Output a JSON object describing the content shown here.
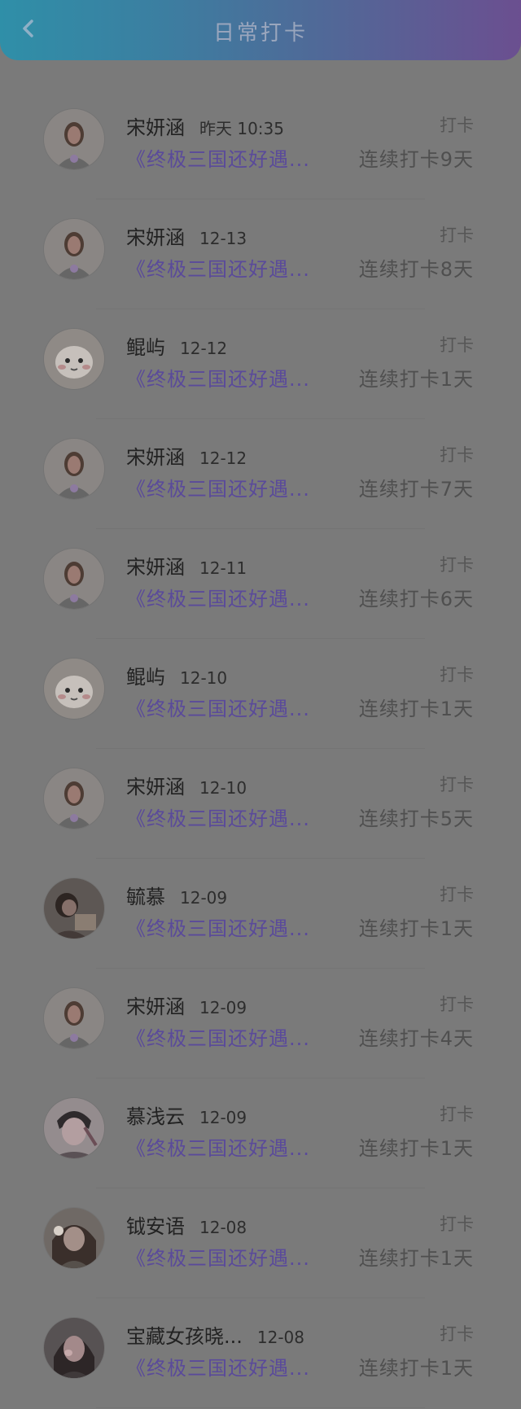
{
  "header": {
    "title": "日常打卡",
    "back_icon": "chevron-left-icon"
  },
  "records": [
    {
      "name": "宋妍涵",
      "time": "昨天 10:35",
      "action": "打卡",
      "course": "《终极三国还好遇...",
      "streak": "连续打卡9天",
      "avatar": "avatar-a"
    },
    {
      "name": "宋妍涵",
      "time": "12-13",
      "action": "打卡",
      "course": "《终极三国还好遇...",
      "streak": "连续打卡8天",
      "avatar": "avatar-a"
    },
    {
      "name": "鲲屿",
      "time": "12-12",
      "action": "打卡",
      "course": "《终极三国还好遇...",
      "streak": "连续打卡1天",
      "avatar": "avatar-b"
    },
    {
      "name": "宋妍涵",
      "time": "12-12",
      "action": "打卡",
      "course": "《终极三国还好遇...",
      "streak": "连续打卡7天",
      "avatar": "avatar-a"
    },
    {
      "name": "宋妍涵",
      "time": "12-11",
      "action": "打卡",
      "course": "《终极三国还好遇...",
      "streak": "连续打卡6天",
      "avatar": "avatar-a"
    },
    {
      "name": "鲲屿",
      "time": "12-10",
      "action": "打卡",
      "course": "《终极三国还好遇...",
      "streak": "连续打卡1天",
      "avatar": "avatar-b"
    },
    {
      "name": "宋妍涵",
      "time": "12-10",
      "action": "打卡",
      "course": "《终极三国还好遇...",
      "streak": "连续打卡5天",
      "avatar": "avatar-a"
    },
    {
      "name": "毓慕",
      "time": "12-09",
      "action": "打卡",
      "course": "《终极三国还好遇...",
      "streak": "连续打卡1天",
      "avatar": "avatar-c"
    },
    {
      "name": "宋妍涵",
      "time": "12-09",
      "action": "打卡",
      "course": "《终极三国还好遇...",
      "streak": "连续打卡4天",
      "avatar": "avatar-a"
    },
    {
      "name": "慕浅云",
      "time": "12-09",
      "action": "打卡",
      "course": "《终极三国还好遇...",
      "streak": "连续打卡1天",
      "avatar": "avatar-d"
    },
    {
      "name": "钺安语",
      "time": "12-08",
      "action": "打卡",
      "course": "《终极三国还好遇...",
      "streak": "连续打卡1天",
      "avatar": "avatar-e"
    },
    {
      "name": "宝藏女孩晓...",
      "time": "12-08",
      "action": "打卡",
      "course": "《终极三国还好遇...",
      "streak": "连续打卡1天",
      "avatar": "avatar-f"
    }
  ],
  "colors": {
    "header_gradient_start": "#2f8fa8",
    "header_gradient_end": "#6b4f90",
    "course_text": "#5a4a9a",
    "background": "#7a7a7a"
  }
}
